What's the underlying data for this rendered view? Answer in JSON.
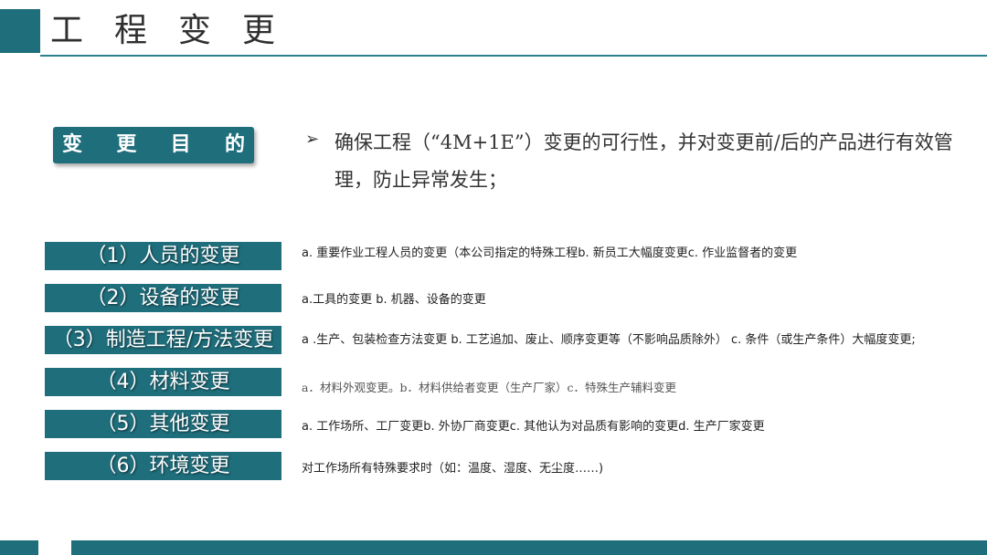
{
  "header": {
    "title": "工程变更"
  },
  "purpose": {
    "badge_chars": [
      "变",
      "更",
      "目",
      "的"
    ],
    "arrow": "➢",
    "text": "确保工程（“4M+1E”）变更的可行性，并对变更前/后的产品进行有效管理，防止异常发生；"
  },
  "categories": [
    {
      "label": "（1）人员的变更",
      "desc": "a. 重要作业工程人员的变更（本公司指定的特殊工程b. 新员工大幅度变更c. 作业监督者的变更"
    },
    {
      "label": "（2）设备的变更",
      "desc": "a.工具的变更 b. 机器、设备的变更"
    },
    {
      "label": "（3）制造工程/方法变更",
      "desc": "a .生产、包装检查方法变更 b. 工艺追加、废止、顺序变更等（不影响品质除外）  c. 条件（或生产条件）大幅度变更;"
    },
    {
      "label": "（4）材料变更",
      "desc": "a．材料外观变更。b．材料供给者变更（生产厂家）c．特殊生产辅料变更"
    },
    {
      "label": "（5）其他变更",
      "desc": "a. 工作场所、工厂变更b. 外协厂商变更c. 其他认为对品质有影响的变更d. 生产厂家变更"
    },
    {
      "label": "（6）环境变更",
      "desc": "对工作场所有特殊要求时（如：温度、湿度、无尘度……)"
    }
  ],
  "colors": {
    "accent": "#1f6e7c",
    "text": "#333333"
  }
}
